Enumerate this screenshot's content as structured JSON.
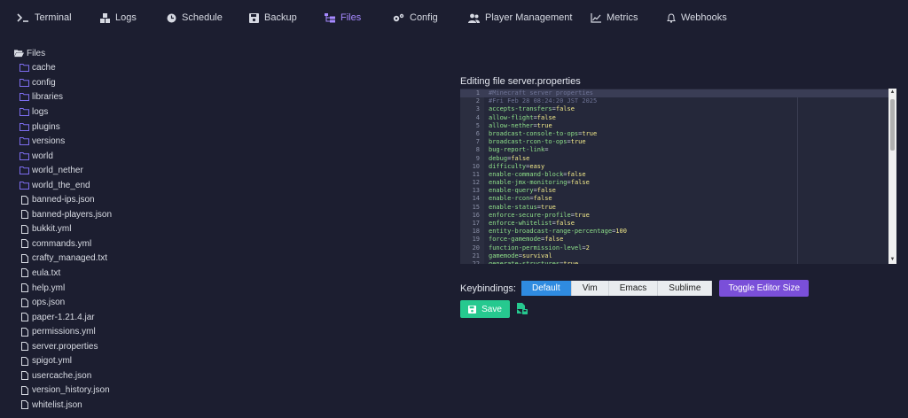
{
  "tabs": [
    {
      "label": "Terminal",
      "icon": "terminal-icon"
    },
    {
      "label": "Logs",
      "icon": "boxes-icon"
    },
    {
      "label": "Schedule",
      "icon": "clock-icon"
    },
    {
      "label": "Backup",
      "icon": "floppy-icon"
    },
    {
      "label": "Files",
      "icon": "folder-tree-icon",
      "active": true
    },
    {
      "label": "Config",
      "icon": "cogs-icon"
    },
    {
      "label": "Player Management",
      "icon": "users-icon"
    },
    {
      "label": "Metrics",
      "icon": "chart-line-icon"
    },
    {
      "label": "Webhooks",
      "icon": "bell-icon"
    }
  ],
  "tree": {
    "root": "Files",
    "folders": [
      "cache",
      "config",
      "libraries",
      "logs",
      "plugins",
      "versions",
      "world",
      "world_nether",
      "world_the_end"
    ],
    "files": [
      "banned-ips.json",
      "banned-players.json",
      "bukkit.yml",
      "commands.yml",
      "crafty_managed.txt",
      "eula.txt",
      "help.yml",
      "ops.json",
      "paper-1.21.4.jar",
      "permissions.yml",
      "server.properties",
      "spigot.yml",
      "usercache.json",
      "version_history.json",
      "whitelist.json"
    ]
  },
  "editor": {
    "title": "Editing file server.properties",
    "lines": [
      {
        "n": "1",
        "text": "#Minecraft server properties",
        "comment": true
      },
      {
        "n": "2",
        "text": "#Fri Feb 28 08:24:20 JST 2025",
        "comment": true
      },
      {
        "n": "3",
        "key": "accepts-transfers",
        "value": "false"
      },
      {
        "n": "4",
        "key": "allow-flight",
        "value": "false"
      },
      {
        "n": "5",
        "key": "allow-nether",
        "value": "true"
      },
      {
        "n": "6",
        "key": "broadcast-console-to-ops",
        "value": "true"
      },
      {
        "n": "7",
        "key": "broadcast-rcon-to-ops",
        "value": "true"
      },
      {
        "n": "8",
        "key": "bug-report-link",
        "value": ""
      },
      {
        "n": "9",
        "key": "debug",
        "value": "false"
      },
      {
        "n": "10",
        "key": "difficulty",
        "value": "easy"
      },
      {
        "n": "11",
        "key": "enable-command-block",
        "value": "false"
      },
      {
        "n": "12",
        "key": "enable-jmx-monitoring",
        "value": "false"
      },
      {
        "n": "13",
        "key": "enable-query",
        "value": "false"
      },
      {
        "n": "14",
        "key": "enable-rcon",
        "value": "false"
      },
      {
        "n": "15",
        "key": "enable-status",
        "value": "true"
      },
      {
        "n": "16",
        "key": "enforce-secure-profile",
        "value": "true"
      },
      {
        "n": "17",
        "key": "enforce-whitelist",
        "value": "false"
      },
      {
        "n": "18",
        "key": "entity-broadcast-range-percentage",
        "value": "100"
      },
      {
        "n": "19",
        "key": "force-gamemode",
        "value": "false"
      },
      {
        "n": "20",
        "key": "function-permission-level",
        "value": "2"
      },
      {
        "n": "21",
        "key": "gamemode",
        "value": "survival"
      },
      {
        "n": "22",
        "key": "generate-structures",
        "value": "true"
      }
    ]
  },
  "keybindings": {
    "label": "Keybindings:",
    "options": [
      "Default",
      "Vim",
      "Emacs",
      "Sublime"
    ],
    "selected": "Default",
    "toggle_label": "Toggle Editor Size"
  },
  "save_label": "Save",
  "colors": {
    "accent": "#a689ff",
    "save": "#26c98f",
    "selected_key": "#2f8be0",
    "toggle": "#7a4fd9"
  }
}
